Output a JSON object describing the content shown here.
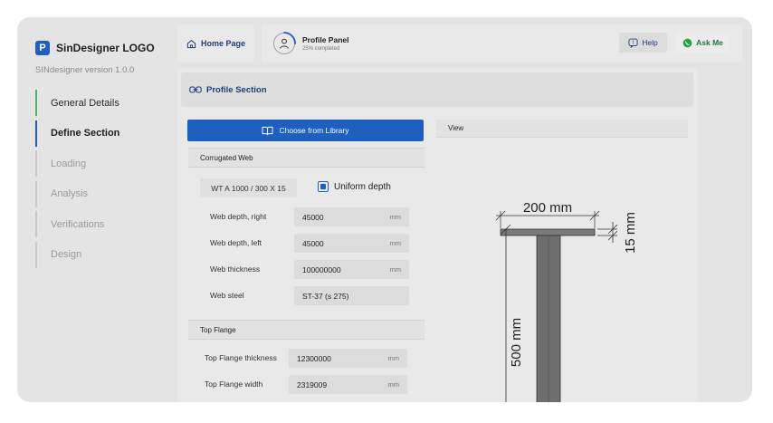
{
  "sidebar": {
    "logo": "SinDesigner LOGO",
    "version": "SINdesigner version 1.0.0",
    "items": [
      {
        "label": "General Details"
      },
      {
        "label": "Define Section"
      },
      {
        "label": "Loading"
      },
      {
        "label": "Analysis"
      },
      {
        "label": "Verifications"
      },
      {
        "label": "Design"
      }
    ]
  },
  "topbar": {
    "home": "Home Page",
    "profile_title": "Profile Panel",
    "profile_sub": "25% completed",
    "profile_progress": 0.25,
    "help": "Help",
    "ask": "Ask Me"
  },
  "section": {
    "title": "Profile Section",
    "library_button": "Choose from Library"
  },
  "web": {
    "title": "Corrugated Web",
    "profile": "WT A 1000 / 300 X 15",
    "uniform_label": "Uniform depth",
    "uniform_checked": true,
    "fields": [
      {
        "label": "Web depth, right",
        "value": "45000",
        "unit": "mm"
      },
      {
        "label": "Web depth, left",
        "value": "45000",
        "unit": "mm"
      },
      {
        "label": "Web thickness",
        "value": "100000000",
        "unit": "mm"
      },
      {
        "label": "Web steel",
        "value": "ST-37 (s 275)",
        "unit": ""
      }
    ]
  },
  "flange": {
    "title": "Top Flange",
    "fields": [
      {
        "label": "Top Flange thickness",
        "value": "12300000",
        "unit": "mm"
      },
      {
        "label": "Top Flange width",
        "value": "2319009",
        "unit": "mm"
      }
    ]
  },
  "view": {
    "title": "View",
    "dim_width": "200 mm",
    "dim_thickness": "15 mm",
    "dim_height": "500 mm"
  },
  "colors": {
    "accent": "#1f5fbf",
    "done": "#4bb56b",
    "ask": "#1f7a3a"
  }
}
